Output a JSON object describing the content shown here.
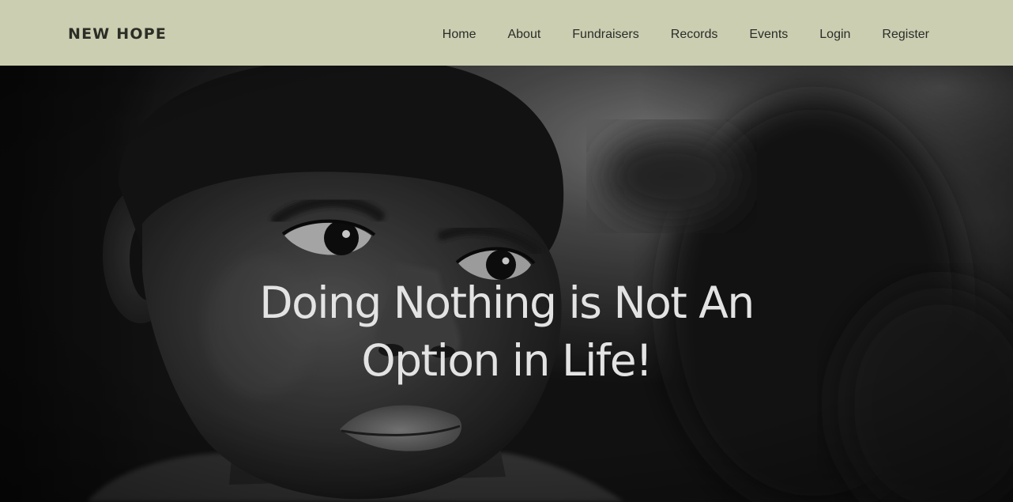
{
  "brand": {
    "name": "NEW HOPE"
  },
  "nav": {
    "items": [
      {
        "label": "Home"
      },
      {
        "label": "About"
      },
      {
        "label": "Fundraisers"
      },
      {
        "label": "Records"
      },
      {
        "label": "Events"
      },
      {
        "label": "Login"
      },
      {
        "label": "Register"
      }
    ]
  },
  "hero": {
    "headline_line1": "Doing Nothing is Not An",
    "headline_line2": "Option in Life!",
    "image_icon": "child-portrait-photo"
  },
  "colors": {
    "navbar_bg": "#cbceb1",
    "nav_text": "#2b2d28",
    "headline_text": "#e3e3e3"
  }
}
